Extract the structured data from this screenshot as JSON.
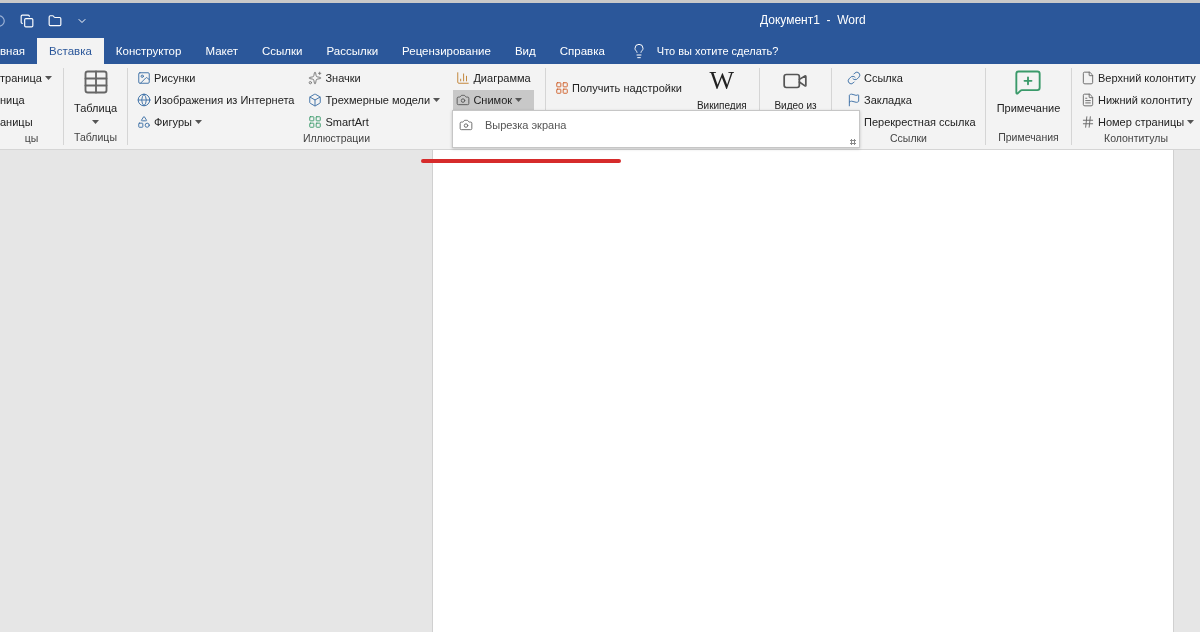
{
  "window": {
    "title": "Документ1  -  Word"
  },
  "tabs": [
    {
      "label": "вная",
      "selected": false
    },
    {
      "label": "Вставка",
      "selected": true
    },
    {
      "label": "Конструктор",
      "selected": false
    },
    {
      "label": "Макет",
      "selected": false
    },
    {
      "label": "Ссылки",
      "selected": false
    },
    {
      "label": "Рассылки",
      "selected": false
    },
    {
      "label": "Рецензирование",
      "selected": false
    },
    {
      "label": "Вид",
      "selected": false
    },
    {
      "label": "Справка",
      "selected": false
    }
  ],
  "tell_me": "Что вы хотите сделать?",
  "ribbon": {
    "pages": {
      "label": "цы",
      "items": [
        {
          "label": "траница",
          "dropdown": true
        },
        {
          "label": "ница",
          "dropdown": false
        },
        {
          "label": "аницы",
          "dropdown": false
        }
      ]
    },
    "tables": {
      "label": "Таблицы",
      "button": "Таблица"
    },
    "illustrations": {
      "label": "Иллюстрации",
      "columns": [
        [
          {
            "label": "Рисунки",
            "dropdown": false,
            "expanded": false
          },
          {
            "label": "Изображения из Интернета",
            "dropdown": false,
            "expanded": false
          },
          {
            "label": "Фигуры",
            "dropdown": true,
            "expanded": false
          }
        ],
        [
          {
            "label": "Значки",
            "dropdown": false,
            "expanded": false
          },
          {
            "label": "Трехмерные модели",
            "dropdown": true,
            "expanded": false
          },
          {
            "label": "SmartArt",
            "dropdown": false,
            "expanded": false
          }
        ],
        [
          {
            "label": "Диаграмма",
            "dropdown": false,
            "expanded": false
          },
          {
            "label": "Снимок",
            "dropdown": true,
            "expanded": true
          }
        ]
      ]
    },
    "addins": {
      "get": "Получить надстройки",
      "wiki_logo": "W",
      "wiki": "Википедия"
    },
    "media": {
      "video": "Видео из"
    },
    "links": {
      "label": "Ссылки",
      "items": [
        "Ссылка",
        "Закладка",
        "Перекрестная ссылка"
      ]
    },
    "comments": {
      "label": "Примечания",
      "button": "Примечание"
    },
    "header_footer": {
      "label": "Колонтитулы",
      "items": [
        {
          "label": "Верхний колонтиту"
        },
        {
          "label": "Нижний колонтиту"
        },
        {
          "label": "Номер страницы",
          "dropdown": true
        }
      ]
    }
  },
  "screenshot_menu": {
    "items": [
      "Вырезка экрана"
    ]
  }
}
